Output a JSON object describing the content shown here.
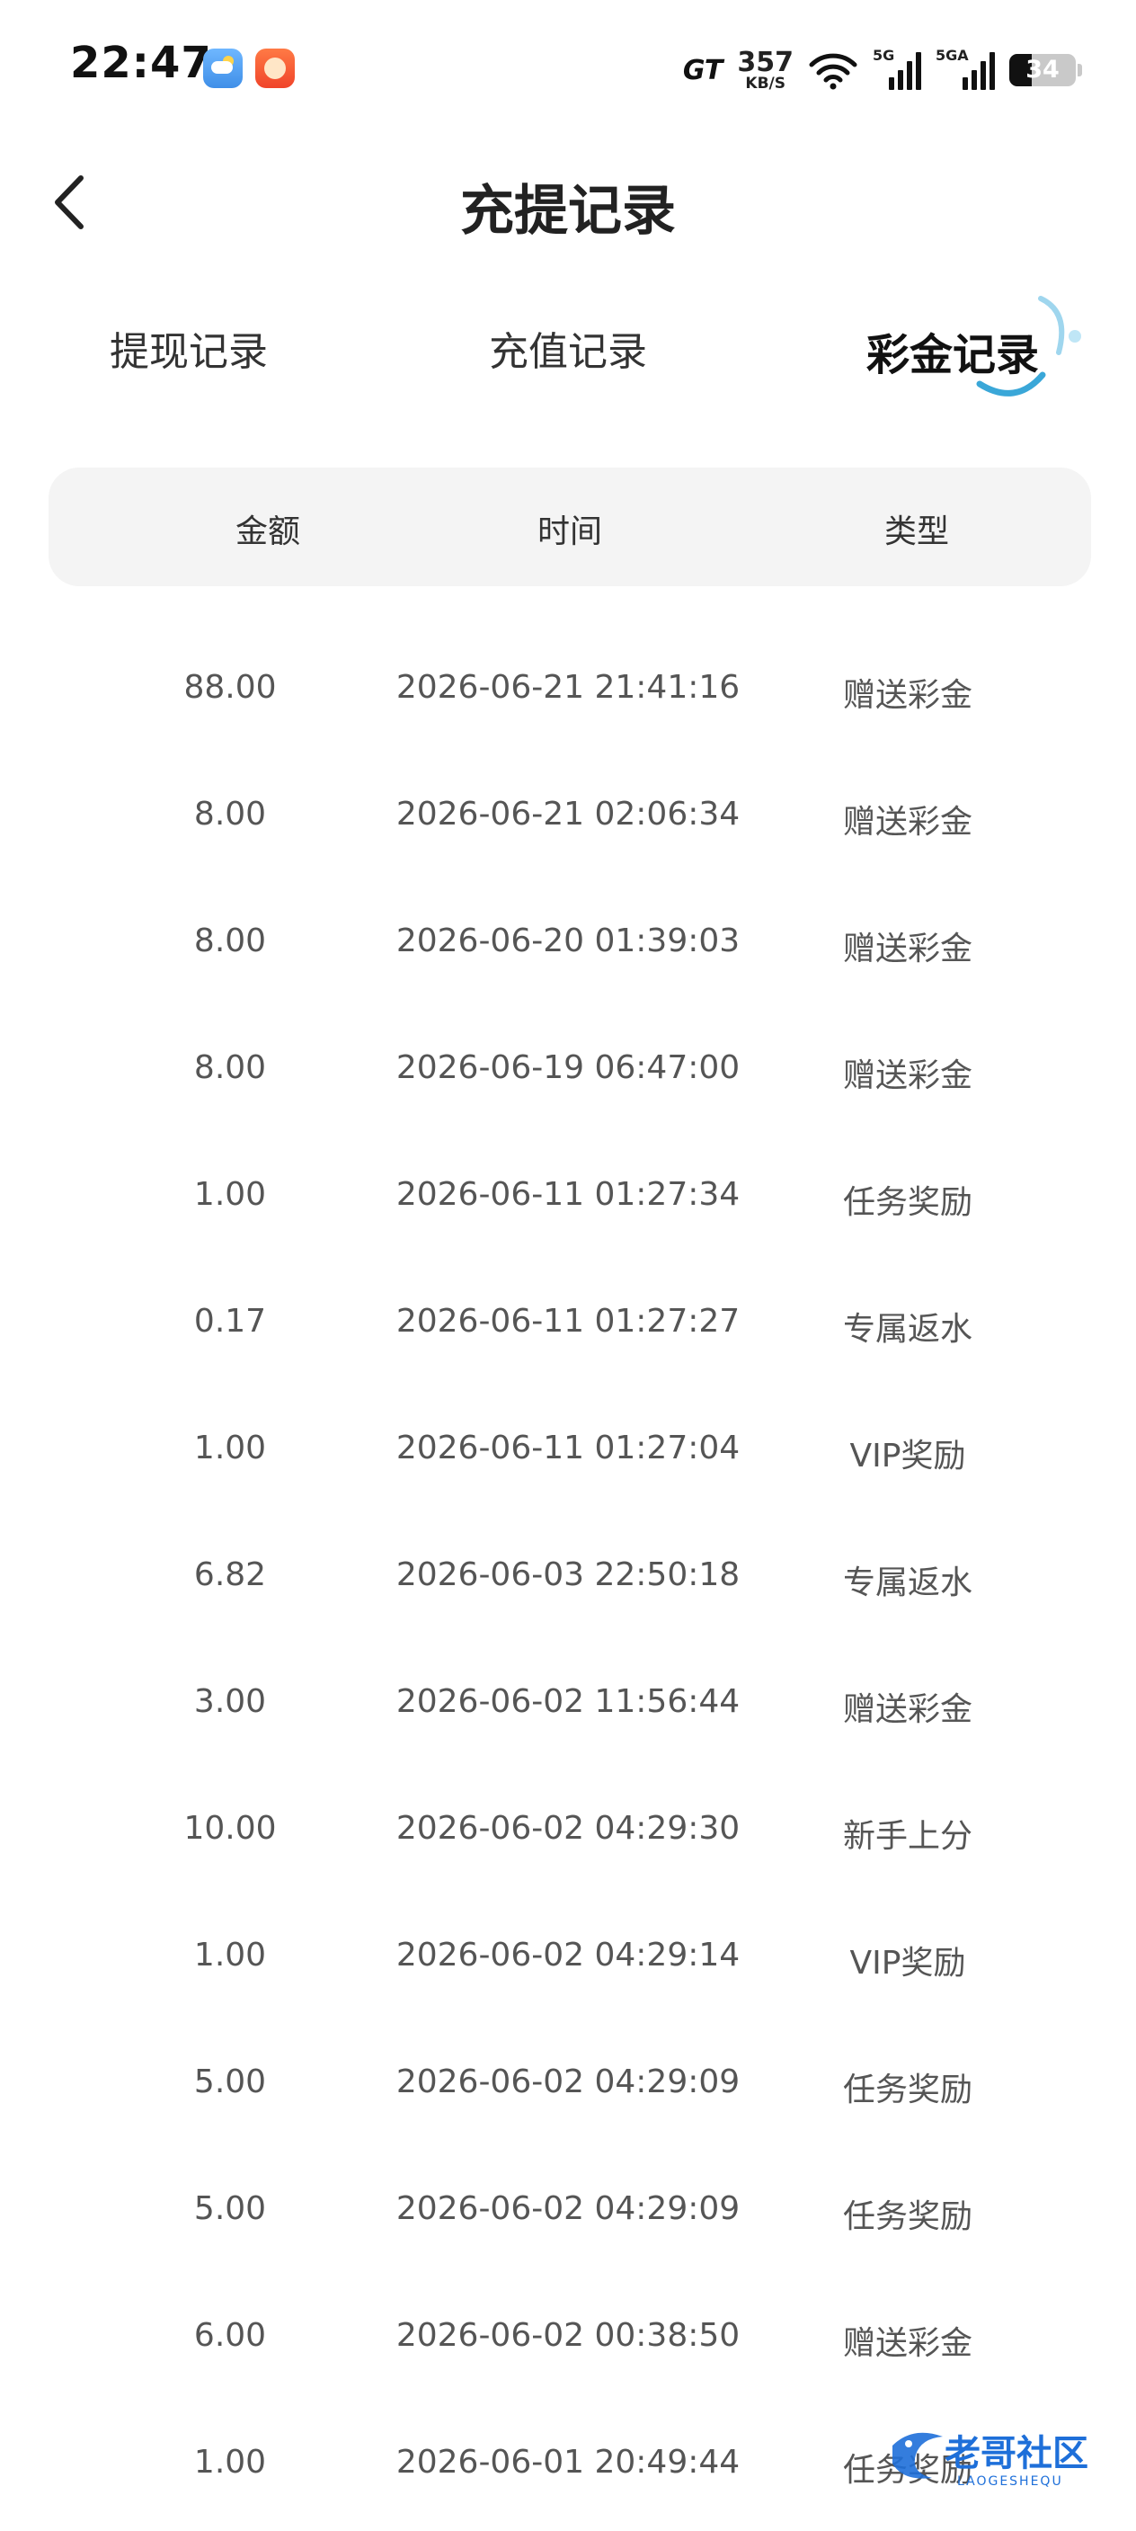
{
  "status_bar": {
    "time": "22:47",
    "network_brand": "GT",
    "speed_value": "357",
    "speed_unit": "KB/S",
    "sim1_label": "5G",
    "sim2_label": "5GA",
    "battery": "34",
    "icons": [
      "weather-app-icon",
      "game-app-icon",
      "wifi-icon",
      "signal-icon",
      "battery-icon"
    ]
  },
  "header": {
    "title": "充提记录",
    "back_icon": "chevron-left-icon"
  },
  "tabs": [
    {
      "label": "提现记录",
      "active": false
    },
    {
      "label": "充值记录",
      "active": false
    },
    {
      "label": "彩金记录",
      "active": true
    }
  ],
  "table": {
    "columns": [
      "金额",
      "时间",
      "类型"
    ],
    "rows": [
      {
        "amount": "88.00",
        "time": "2026-06-21 21:41:16",
        "type": "赠送彩金"
      },
      {
        "amount": "8.00",
        "time": "2026-06-21 02:06:34",
        "type": "赠送彩金"
      },
      {
        "amount": "8.00",
        "time": "2026-06-20 01:39:03",
        "type": "赠送彩金"
      },
      {
        "amount": "8.00",
        "time": "2026-06-19 06:47:00",
        "type": "赠送彩金"
      },
      {
        "amount": "1.00",
        "time": "2026-06-11 01:27:34",
        "type": "任务奖励"
      },
      {
        "amount": "0.17",
        "time": "2026-06-11 01:27:27",
        "type": "专属返水"
      },
      {
        "amount": "1.00",
        "time": "2026-06-11 01:27:04",
        "type": "VIP奖励"
      },
      {
        "amount": "6.82",
        "time": "2026-06-03 22:50:18",
        "type": "专属返水"
      },
      {
        "amount": "3.00",
        "time": "2026-06-02 11:56:44",
        "type": "赠送彩金"
      },
      {
        "amount": "10.00",
        "time": "2026-06-02 04:29:30",
        "type": "新手上分"
      },
      {
        "amount": "1.00",
        "time": "2026-06-02 04:29:14",
        "type": "VIP奖励"
      },
      {
        "amount": "5.00",
        "time": "2026-06-02 04:29:09",
        "type": "任务奖励"
      },
      {
        "amount": "5.00",
        "time": "2026-06-02 04:29:09",
        "type": "任务奖励"
      },
      {
        "amount": "6.00",
        "time": "2026-06-02 00:38:50",
        "type": "赠送彩金"
      },
      {
        "amount": "1.00",
        "time": "2026-06-01 20:49:44",
        "type": "任务奖励"
      }
    ]
  },
  "watermark": {
    "text": "老哥社区",
    "subtext": "LAOGESHEQU"
  },
  "colors": {
    "background": "#ffffff",
    "header_bg": "#f4f4f4",
    "text_primary": "#222222",
    "text_secondary": "#555555",
    "accent_deco": "#3aa7d8",
    "watermark": "#1e6fd9"
  }
}
